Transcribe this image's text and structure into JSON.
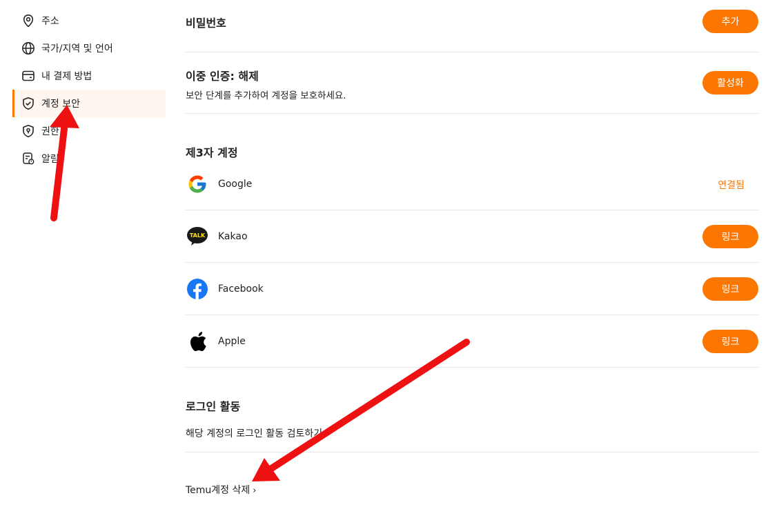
{
  "sidebar": {
    "items": [
      {
        "label": "주소",
        "icon": "location-pin-icon"
      },
      {
        "label": "국가/지역 및 언어",
        "icon": "globe-icon"
      },
      {
        "label": "내 결제 방법",
        "icon": "wallet-icon"
      },
      {
        "label": "계정 보안",
        "icon": "shield-check-icon",
        "active": true
      },
      {
        "label": "권한",
        "icon": "permission-shield-icon"
      },
      {
        "label": "알림",
        "icon": "notification-icon"
      }
    ]
  },
  "password": {
    "title": "비밀번호",
    "button": "추가"
  },
  "two_factor": {
    "title": "이중 인증: 해제",
    "description": "보안 단계를 추가하여 계정을 보호하세요.",
    "button": "활성화"
  },
  "third_party": {
    "title": "제3자 계정",
    "accounts": [
      {
        "name": "Google",
        "status": "연결됨",
        "icon": "google-logo-icon"
      },
      {
        "name": "Kakao",
        "button": "링크",
        "icon": "kakao-talk-logo-icon",
        "logo_text": "TALK"
      },
      {
        "name": "Facebook",
        "button": "링크",
        "icon": "facebook-logo-icon"
      },
      {
        "name": "Apple",
        "button": "링크",
        "icon": "apple-logo-icon"
      }
    ]
  },
  "login_activity": {
    "title": "로그인 활동",
    "link": "해당 계정의 로그인 활동 검토하기"
  },
  "delete_account": {
    "label": "Temu계정 삭제"
  },
  "colors": {
    "accent": "#fb7701",
    "annotation_arrow": "#ee1111"
  }
}
